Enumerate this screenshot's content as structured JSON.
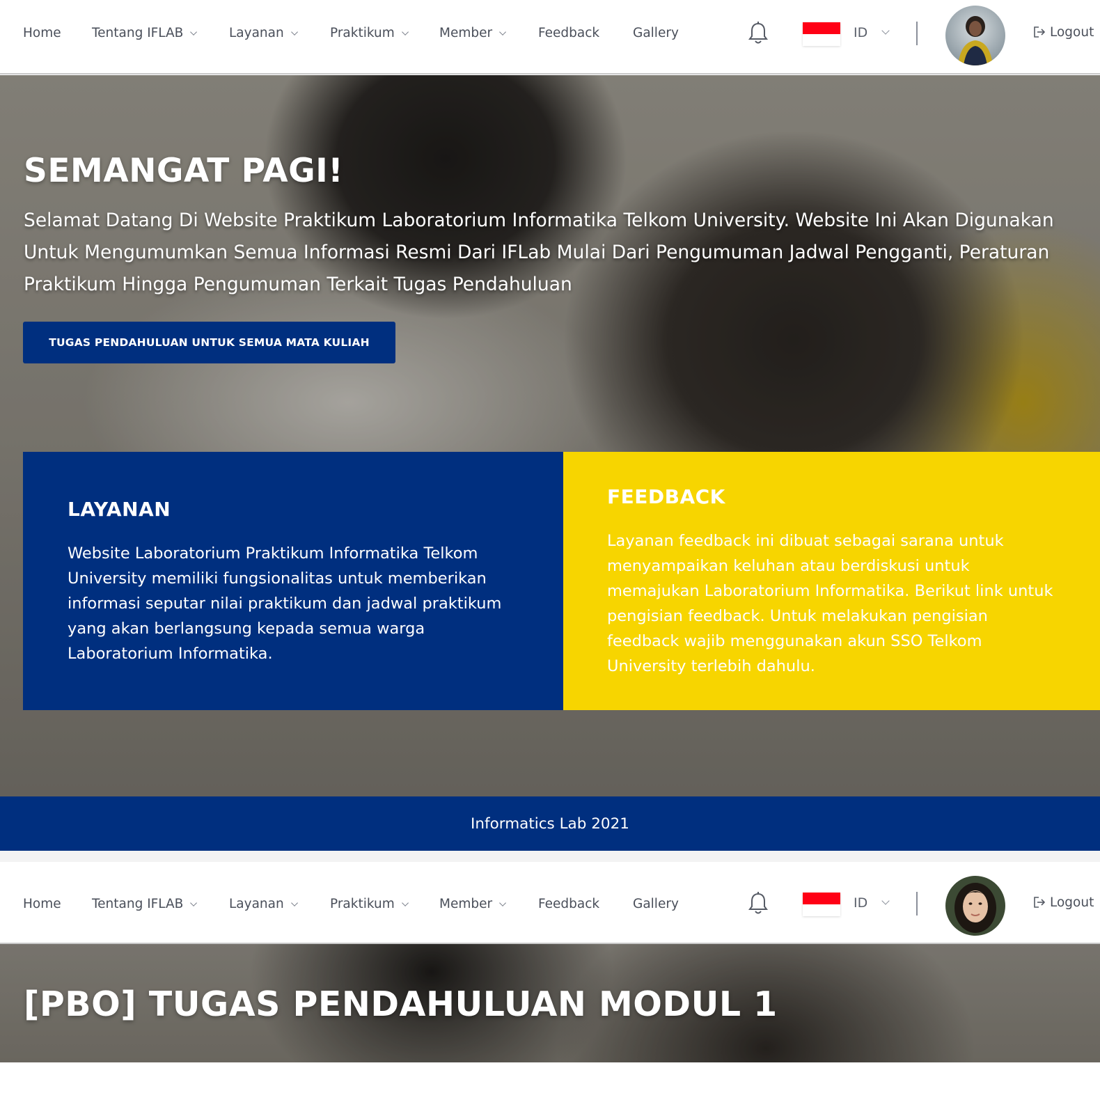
{
  "nav": {
    "items": [
      {
        "label": "Home",
        "dropdown": false
      },
      {
        "label": "Tentang IFLAB",
        "dropdown": true
      },
      {
        "label": "Layanan",
        "dropdown": true
      },
      {
        "label": "Praktikum",
        "dropdown": true
      },
      {
        "label": "Member",
        "dropdown": true
      },
      {
        "label": "Feedback",
        "dropdown": false
      },
      {
        "label": "Gallery",
        "dropdown": false
      }
    ],
    "language": "ID",
    "logout_label": "Logout",
    "notification_icon": "bell-icon",
    "flag_icon": "indonesia-flag-icon"
  },
  "hero": {
    "title": "SEMANGAT PAGI!",
    "text": "Selamat Datang Di Website Praktikum Laboratorium Informatika Telkom University. Website Ini Akan Digunakan Untuk Mengumumkan Semua Informasi Resmi Dari IFLab Mulai Dari Pengumuman Jadwal Pengganti, Peraturan Praktikum Hingga Pengumuman Terkait Tugas Pendahuluan",
    "button_label": "TUGAS PENDAHULUAN UNTUK SEMUA MATA KULIAH"
  },
  "cards": {
    "layanan": {
      "title": "LAYANAN",
      "text": "Website Laboratorium Praktikum Informatika Telkom University memiliki fungsionalitas untuk memberikan informasi seputar nilai praktikum dan jadwal praktikum yang akan berlangsung kepada semua warga Laboratorium Informatika."
    },
    "feedback": {
      "title": "FEEDBACK",
      "text": "Layanan feedback ini dibuat sebagai sarana untuk menyampaikan keluhan atau berdiskusi untuk memajukan Laboratorium Informatika. Berikut link untuk pengisian feedback. Untuk melakukan pengisian feedback wajib menggunakan akun SSO Telkom University terlebih dahulu."
    }
  },
  "footer": {
    "text": "Informatics Lab 2021"
  },
  "page2": {
    "title": "[PBO] TUGAS PENDAHULUAN MODUL 1"
  },
  "colors": {
    "primary_blue": "#002f7f",
    "accent_yellow": "#f7d500",
    "flag_red": "#ff0015"
  }
}
